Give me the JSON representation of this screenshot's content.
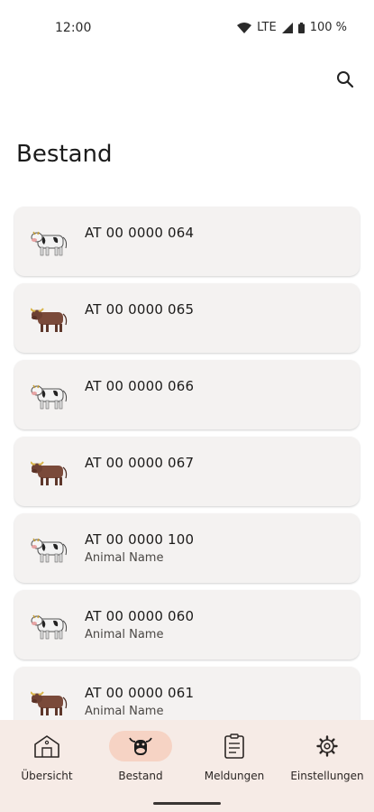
{
  "status": {
    "time": "12:00",
    "network": "LTE",
    "battery": "100 %"
  },
  "page": {
    "title": "Bestand"
  },
  "animals": [
    {
      "tag": "AT 00 0000 064",
      "name": "",
      "kind": "cow-icon"
    },
    {
      "tag": "AT 00 0000 065",
      "name": "",
      "kind": "bull-icon"
    },
    {
      "tag": "AT 00 0000 066",
      "name": "",
      "kind": "cow-icon"
    },
    {
      "tag": "AT 00 0000 067",
      "name": "",
      "kind": "bull-icon"
    },
    {
      "tag": "AT 00 0000 100",
      "name": "Animal Name",
      "kind": "cow-icon"
    },
    {
      "tag": "AT 00 0000 060",
      "name": "Animal Name",
      "kind": "cow-icon"
    },
    {
      "tag": "AT 00 0000 061",
      "name": "Animal Name",
      "kind": "bull-icon"
    }
  ],
  "nav": {
    "items": [
      {
        "label": "Übersicht",
        "icon": "barn-icon"
      },
      {
        "label": "Bestand",
        "icon": "cow-face-icon",
        "active": true
      },
      {
        "label": "Meldungen",
        "icon": "clipboard-icon"
      },
      {
        "label": "Einstellungen",
        "icon": "gear-icon"
      }
    ]
  },
  "colors": {
    "nav_bg": "#f6ebe6",
    "active_pill": "#f6d3c4",
    "card_bg": "#f4f2f1"
  }
}
